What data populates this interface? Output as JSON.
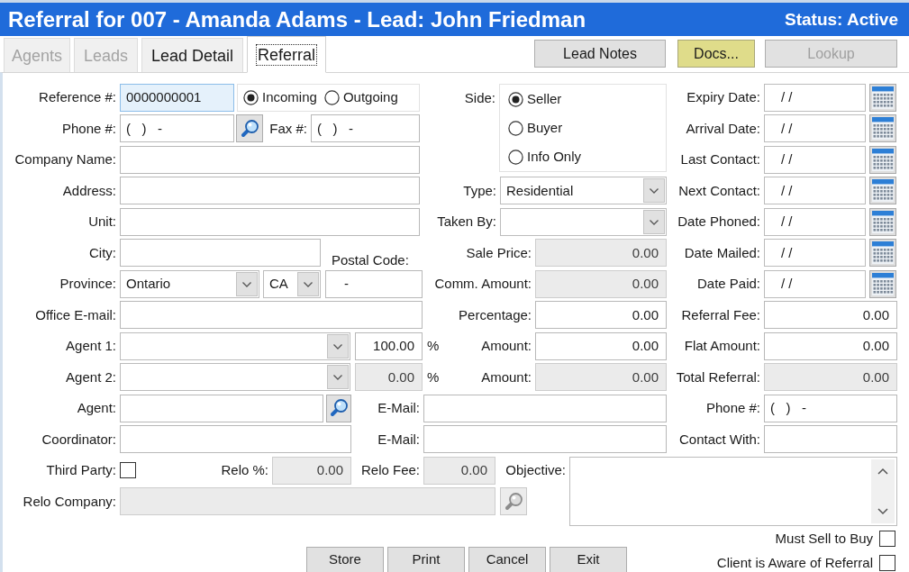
{
  "window": {
    "title": "Referral for 007 - Amanda Adams - Lead: John Friedman",
    "status": "Status: Active"
  },
  "tabs": [
    {
      "label": "Agents",
      "selected": false,
      "disabled": true
    },
    {
      "label": "Leads",
      "selected": false,
      "disabled": true
    },
    {
      "label": "Lead Detail",
      "selected": false,
      "disabled": false
    },
    {
      "label": "Referral",
      "selected": true,
      "disabled": false
    }
  ],
  "toolbar_buttons": [
    {
      "label": "Lead Notes",
      "highlighted": false,
      "disabled": false
    },
    {
      "label": "Docs...",
      "highlighted": true,
      "disabled": false
    },
    {
      "label": "Lookup",
      "highlighted": false,
      "disabled": true
    }
  ],
  "form": {
    "left_column": [
      {
        "kind": "text",
        "label": "Reference #:",
        "value": "0000000001",
        "disabled": false,
        "focused": true
      },
      {
        "kind": "radio_group",
        "options": [
          {
            "label": "Incoming",
            "selected": true
          },
          {
            "label": "Outgoing",
            "selected": false
          }
        ]
      },
      {
        "kind": "text",
        "label": "Phone #:",
        "value": "(   )   -",
        "disabled": false,
        "focused": false
      },
      {
        "kind": "lookup",
        "disabled": false
      },
      {
        "kind": "text",
        "label": "Fax #:",
        "value": "(   )   -",
        "disabled": false,
        "focused": false
      },
      {
        "kind": "text",
        "label": "Company Name:",
        "disabled": false,
        "focused": false
      },
      {
        "kind": "text",
        "label": "Address:",
        "disabled": false,
        "focused": false
      },
      {
        "kind": "text",
        "label": "Unit:",
        "disabled": false,
        "focused": false
      },
      {
        "kind": "text",
        "label": "City:",
        "disabled": false,
        "focused": false
      },
      {
        "kind": "caption",
        "label": "Postal Code:"
      },
      {
        "kind": "select",
        "label": "Province:",
        "value": "Ontario"
      },
      {
        "kind": "select",
        "value": "CA"
      },
      {
        "kind": "text",
        "value": "-",
        "disabled": false,
        "focused": false
      },
      {
        "kind": "text",
        "label": "Office E-mail:",
        "disabled": false,
        "focused": false
      },
      {
        "kind": "select",
        "label": "Agent 1:"
      },
      {
        "kind": "text",
        "value": "100.00",
        "suffix": "%",
        "disabled": false,
        "focused": false
      },
      {
        "kind": "select",
        "label": "Agent 2:"
      },
      {
        "kind": "text",
        "value": "0.00",
        "suffix": "%",
        "disabled": true,
        "focused": false
      },
      {
        "kind": "text",
        "label": "Agent:",
        "disabled": false,
        "focused": false
      },
      {
        "kind": "lookup",
        "disabled": false
      },
      {
        "kind": "text",
        "label": "Coordinator:",
        "disabled": false,
        "focused": false
      },
      {
        "kind": "checkbox",
        "label": "Third Party:",
        "checked": false
      },
      {
        "kind": "text",
        "label": "Relo %:",
        "value": "0.00",
        "disabled": true,
        "focused": false
      },
      {
        "kind": "text",
        "label": "Relo Fee:",
        "value": "0.00",
        "disabled": true,
        "focused": false
      },
      {
        "kind": "text",
        "label": "Relo Company:",
        "disabled": true,
        "focused": false
      },
      {
        "kind": "lookup",
        "disabled": true
      }
    ],
    "middle_column": [
      {
        "kind": "radio_group",
        "label": "Side:",
        "options": [
          {
            "label": "Seller",
            "selected": true
          },
          {
            "label": "Buyer",
            "selected": false
          },
          {
            "label": "Info Only",
            "selected": false
          }
        ]
      },
      {
        "kind": "select",
        "label": "Type:",
        "value": "Residential"
      },
      {
        "kind": "select",
        "label": "Taken By:"
      },
      {
        "kind": "text",
        "label": "Sale Price:",
        "value": "0.00",
        "disabled": true,
        "focused": false
      },
      {
        "kind": "text",
        "label": "Comm. Amount:",
        "value": "0.00",
        "disabled": true,
        "focused": false
      },
      {
        "kind": "text",
        "label": "Percentage:",
        "value": "0.00",
        "disabled": false,
        "focused": false
      },
      {
        "kind": "text",
        "label": "Amount:",
        "value": "0.00",
        "disabled": false,
        "focused": false
      },
      {
        "kind": "text",
        "label": "Amount:",
        "value": "0.00",
        "disabled": true,
        "focused": false
      },
      {
        "kind": "text",
        "label": "E-Mail:",
        "disabled": false,
        "focused": false
      },
      {
        "kind": "text",
        "label": "E-Mail:",
        "disabled": false,
        "focused": false
      },
      {
        "kind": "memo",
        "label": "Objective:"
      }
    ],
    "right_column": [
      {
        "kind": "date",
        "label": "Expiry Date:",
        "value": "/ /"
      },
      {
        "kind": "date",
        "label": "Arrival Date:",
        "value": "/ /"
      },
      {
        "kind": "date",
        "label": "Last Contact:",
        "value": "/ /"
      },
      {
        "kind": "date",
        "label": "Next Contact:",
        "value": "/ /"
      },
      {
        "kind": "date",
        "label": "Date Phoned:",
        "value": "/ /"
      },
      {
        "kind": "date",
        "label": "Date Mailed:",
        "value": "/ /"
      },
      {
        "kind": "date",
        "label": "Date Paid:",
        "value": "/ /"
      },
      {
        "kind": "text",
        "label": "Referral Fee:",
        "value": "0.00",
        "disabled": false,
        "focused": false
      },
      {
        "kind": "text",
        "label": "Flat Amount:",
        "value": "0.00",
        "disabled": false,
        "focused": false
      },
      {
        "kind": "text",
        "label": "Total Referral:",
        "value": "0.00",
        "disabled": true,
        "focused": false
      },
      {
        "kind": "text",
        "label": "Phone #:",
        "value": "(   )   -",
        "disabled": false,
        "focused": false
      },
      {
        "kind": "text",
        "label": "Contact With:",
        "disabled": false,
        "focused": false
      }
    ]
  },
  "flags": [
    {
      "label": "Must Sell to Buy",
      "checked": false
    },
    {
      "label": "Client is Aware of Referral",
      "checked": false
    }
  ],
  "buttons": [
    "Store",
    "Print",
    "Cancel",
    "Exit"
  ]
}
